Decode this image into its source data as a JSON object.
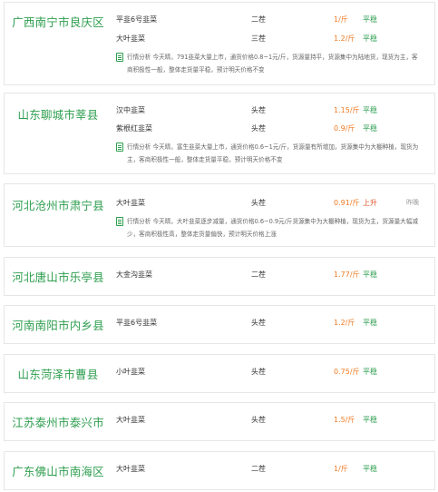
{
  "cards": [
    {
      "region": "广西南宁市良庆区",
      "rows": [
        {
          "name": "平韭6号韭菜",
          "grade": "二茬",
          "price": "1/斤",
          "trend": "平稳"
        },
        {
          "name": "大叶韭菜",
          "grade": "三茬",
          "price": "1.2/斤",
          "trend": "平稳"
        }
      ],
      "analysis": "行情分析 今天晴，791韭菜大量上市，通货价格0.8~1元/斤，货源量持平，货源集中为陆地货，现货为主，客商积极性一般，整体走货量平稳，预计明天价格不变"
    },
    {
      "region": "山东聊城市莘县",
      "rows": [
        {
          "name": "汉中韭菜",
          "grade": "头茬",
          "price": "1.15/斤",
          "trend": "平稳"
        },
        {
          "name": "紫根红韭菜",
          "grade": "头茬",
          "price": "0.9/斤",
          "trend": "平稳"
        }
      ],
      "analysis": "行情分析 今天晴，富生韭菜大量上市，通货价格0.6~1元/斤，货源量有所增加，货源集中为大棚种植，现货为主，客商积极性一般，整体走货量平稳，预计明天价格不变"
    },
    {
      "region": "河北沧州市肃宁县",
      "rows": [
        {
          "name": "大叶韭菜",
          "grade": "头茬",
          "price": "0.91/斤",
          "trend": "上升",
          "time": "昨晚"
        }
      ],
      "analysis": "行情分析 今天晴，大叶韭菜逐步减量，通货价格0.6~0.9元/斤货源集中为大棚种植，现货为主，货源量大幅减少，客商积极性高，整体走货量偏快，预计明天价格上涨"
    },
    {
      "region": "河北唐山市乐亭县",
      "rows": [
        {
          "name": "大金沟韭菜",
          "grade": "二茬",
          "price": "1.77/斤",
          "trend": "平稳"
        }
      ]
    },
    {
      "region": "河南南阳市内乡县",
      "rows": [
        {
          "name": "平韭6号韭菜",
          "grade": "头茬",
          "price": "1.2/斤",
          "trend": "平稳"
        }
      ]
    },
    {
      "region": "山东菏泽市曹县",
      "rows": [
        {
          "name": "小叶韭菜",
          "grade": "头茬",
          "price": "0.75/斤",
          "trend": "平稳"
        }
      ]
    },
    {
      "region": "江苏泰州市泰兴市",
      "rows": [
        {
          "name": "大叶韭菜",
          "grade": "头茬",
          "price": "1.5/斤",
          "trend": "平稳"
        }
      ]
    },
    {
      "region": "广东佛山市南海区",
      "rows": [
        {
          "name": "大叶韭菜",
          "grade": "二茬",
          "price": "1/斤",
          "trend": "平稳"
        }
      ]
    }
  ],
  "colors": {
    "region": "#2e9e4f",
    "price": "#f07a22",
    "trend_flat": "#2e9e4f",
    "trend_up": "#e0562b"
  },
  "icons": {
    "analysis": "note-icon"
  }
}
